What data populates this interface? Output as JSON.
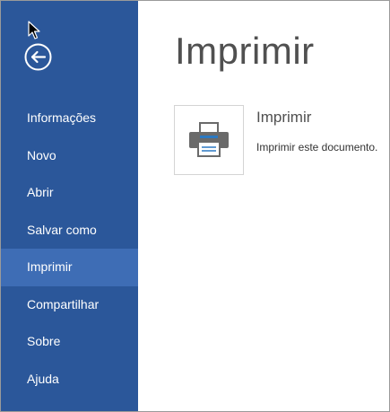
{
  "sidebar": {
    "back_icon": "back-arrow-icon",
    "items": [
      {
        "label": "Informações"
      },
      {
        "label": "Novo"
      },
      {
        "label": "Abrir"
      },
      {
        "label": "Salvar como"
      },
      {
        "label": "Imprimir",
        "active": true
      },
      {
        "label": "Compartilhar"
      },
      {
        "label": "Sobre"
      },
      {
        "label": "Ajuda"
      }
    ]
  },
  "main": {
    "title": "Imprimir",
    "print_option": {
      "icon": "printer-icon",
      "heading": "Imprimir",
      "description": "Imprimir este documento."
    }
  },
  "colors": {
    "sidebar_bg": "#2b579a",
    "active_item_bg": "#3e6db5",
    "text_on_sidebar": "#ffffff",
    "title_text": "#505050"
  }
}
